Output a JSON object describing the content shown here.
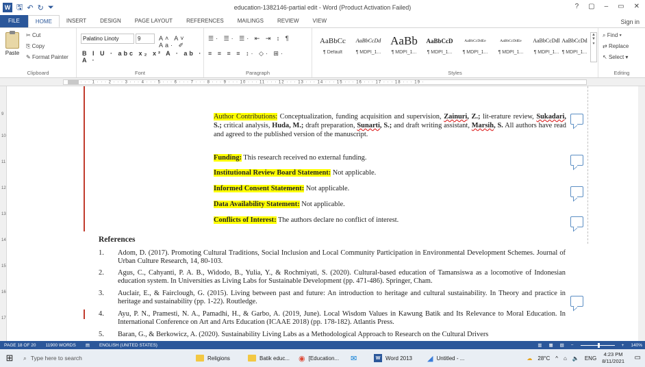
{
  "window": {
    "title": "education-1382146-partial edit - Word (Product Activation Failed)",
    "controls": [
      "?",
      "▢",
      "–",
      "▭",
      "✕"
    ]
  },
  "tabs": [
    "FILE",
    "HOME",
    "INSERT",
    "DESIGN",
    "PAGE LAYOUT",
    "REFERENCES",
    "MAILINGS",
    "REVIEW",
    "VIEW"
  ],
  "signin": "Sign in",
  "ribbon": {
    "clipboard": {
      "paste": "Paste",
      "cut": "Cut",
      "copy": "Copy",
      "format_painter": "Format Painter",
      "label": "Clipboard"
    },
    "font": {
      "name": "Palatino Linoty",
      "size": "9",
      "label": "Font"
    },
    "paragraph": {
      "label": "Paragraph"
    },
    "styles": {
      "label": "Styles",
      "items": [
        {
          "preview": "AaBbCc",
          "name": "¶ Default"
        },
        {
          "preview": "AaBbCcDd",
          "name": "¶ MDPI_1..."
        },
        {
          "preview": "AaBb",
          "name": "¶ MDPI_1..."
        },
        {
          "preview": "AaBbCcD",
          "name": "¶ MDPI_1..."
        },
        {
          "preview": "AaBbCcDdEe",
          "name": "¶ MDPI_1..."
        },
        {
          "preview": "AaBbCcDdEe",
          "name": "¶ MDPI_1..."
        },
        {
          "preview": "AaBbCcDdl",
          "name": "¶ MDPI_1..."
        },
        {
          "preview": "AaBbCcDd",
          "name": "¶ MDPI_1..."
        }
      ]
    },
    "editing": {
      "find": "Find",
      "replace": "Replace",
      "select": "Select",
      "label": "Editing"
    }
  },
  "back_matter": {
    "author_contrib_label": "Author Contributions:",
    "author_contrib_text_1": " Conceptualization, funding acquisition and supervision, ",
    "zainuri": "Zainuri",
    "author_contrib_text_2": "lit-erature review, ",
    "sukadari": "Sukadari",
    "author_contrib_text_3": " critical analysis, ",
    "huda": "Huda, M.",
    "author_contrib_text_4": " draft preparation, ",
    "sunarti": "Sunarti",
    "author_contrib_text_5": " and draft writing assistant, ",
    "marsih": "Marsih",
    "author_contrib_text_6": " All authors have read and agreed to the published version of the manuscript.",
    "funding_label": "Funding:",
    "funding_text": "  This research received no external funding.",
    "irb_label": "Institutional Review Board Statement:",
    "irb_text": " Not applicable.",
    "consent_label": "Informed Consent Statement:",
    "consent_text": " Not applicable.",
    "data_label": "Data Availability Statement:",
    "data_text": " Not applicable.",
    "conflicts_label": "Conflicts of Interest:",
    "conflicts_text": " The authors declare no conflict of interest."
  },
  "references": {
    "heading": "References",
    "items": [
      {
        "num": "1.",
        "text": "Adom, D. (2017). Promoting Cultural Traditions, Social Inclusion and Local Community Participation in Environmental Development Schemes. Journal of Urban Culture Research, 14, 80-103."
      },
      {
        "num": "2.",
        "text": "Agus, C., Cahyanti, P. A. B., Widodo, B., Yulia, Y., & Rochmiyati, S. (2020). Cultural-based education of Tamansiswa as a locomotive of Indonesian education system. In Universities as Living Labs for Sustainable Development (pp. 471-486). Springer, Cham."
      },
      {
        "num": "3.",
        "text": "Auclair, E., & Fairclough, G. (2015). Living between past and future: An introduction to heritage and cultural sustainability. In Theory and practice in heritage and sustainability (pp. 1-22). Routledge."
      },
      {
        "num": "4.",
        "text": "Ayu, P. N., Pramesti, N. A., Pamadhi, H., & Garbo, A. (2019, June). Local Wisdom Values in Kawung Batik and Its Relevance to Moral Education. In International Conference on Art and Arts Education (ICAAE 2018) (pp. 178-182). Atlantis Press."
      },
      {
        "num": "5.",
        "text": "Baran, G., & Berkowicz, A. (2020). Sustainability Living Labs as a Methodological Approach to Research on the Cultural Drivers"
      }
    ]
  },
  "status": {
    "page": "PAGE 18 OF 20",
    "words": "11900 WORDS",
    "lang": "ENGLISH (UNITED STATES)",
    "zoom": "140%"
  },
  "taskbar": {
    "search_placeholder": "Type here to search",
    "apps": [
      "Religions",
      "Batik educ...",
      "[Education...",
      "",
      "Word 2013",
      "Untitled - ..."
    ],
    "weather": "28°C",
    "lang": "ENG",
    "time": "4:23 PM",
    "date": "8/11/2021"
  }
}
